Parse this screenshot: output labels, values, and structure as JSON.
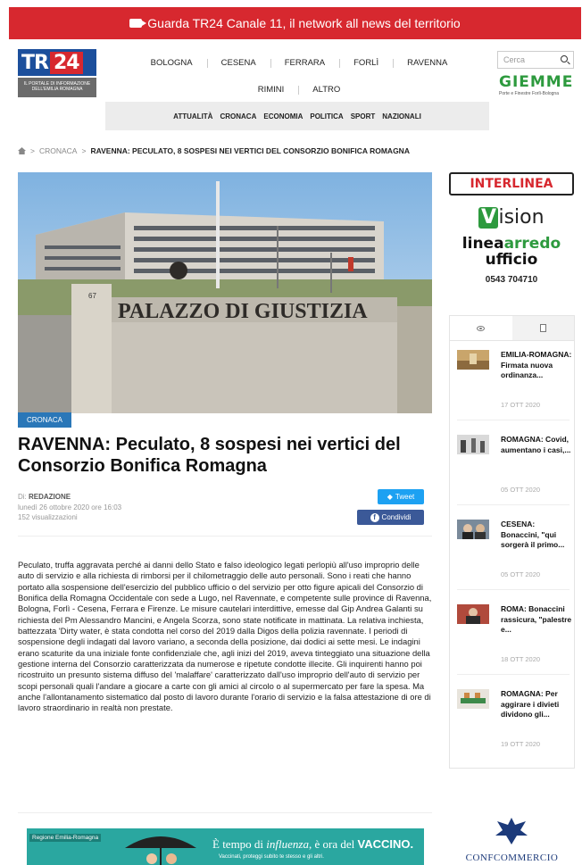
{
  "topbar": {
    "text": "Guarda TR24 Canale 11, il network all news del territorio"
  },
  "logo": {
    "main": "TR",
    "num": "24",
    "tagline": "IL PORTALE DI INFORMAZIONE DELL'EMILIA ROMAGNA"
  },
  "nav": {
    "cities_row1": [
      "BOLOGNA",
      "CESENA",
      "FERRARA",
      "FORLÌ",
      "RAVENNA"
    ],
    "cities_row2": [
      "RIMINI",
      "ALTRO"
    ],
    "categories": [
      "ATTUALITÀ",
      "CRONACA",
      "ECONOMIA",
      "POLITICA",
      "SPORT",
      "NAZIONALI"
    ]
  },
  "search": {
    "placeholder": "Cerca"
  },
  "sponsor_top": {
    "name": "GIEMME",
    "sub": "Porte e Finestre Forlì-Bologna"
  },
  "breadcrumb": {
    "section": "CRONACA",
    "current": "RAVENNA: PECULATO, 8 SOSPESI NEI VERTICI DEL CONSORZIO BONIFICA ROMAGNA"
  },
  "hero": {
    "sign": "PALAZZO DI GIUSTIZIA",
    "number": "67"
  },
  "article": {
    "category": "CRONACA",
    "title": "RAVENNA: Peculato, 8 sospesi nei vertici del Consorzio Bonifica Romagna",
    "author_prefix": "Di: ",
    "author": "REDAZIONE",
    "date": "lunedì 26 ottobre 2020 ore 16:03",
    "views": "152 visualizzazioni",
    "tweet": "Tweet",
    "share": "Condividi",
    "body": "Peculato, truffa aggravata perché ai danni dello Stato e falso ideologico legati perlopiù all'uso improprio delle auto di servizio e alla richiesta di rimborsi per il chilometraggio delle auto personali. Sono i reati che hanno portato alla sospensione dell'esercizio del pubblico ufficio o del servizio per otto figure apicali del Consorzio di Bonifica della Romagna Occidentale con sede a Lugo, nel Ravennate, e competente sulle province di Ravenna, Bologna, Forlì - Cesena, Ferrara e Firenze. Le misure cautelari interdittive, emesse dal Gip Andrea Galanti su richiesta del Pm Alessandro Mancini, e Angela Scorza, sono state notificate in mattinata. La relativa inchiesta, battezzata 'Dirty water, è stata condotta nel corso del 2019 dalla Digos della polizia ravennate. I periodi di sospensione degli indagati dal lavoro variano, a seconda della posizione, dai dodici ai sette mesi. Le indagini erano scaturite da una iniziale fonte confidenziale che, agli inizi del 2019, aveva tinteggiato una situazione della gestione interna del Consorzio caratterizzata da numerose e ripetute condotte illecite. Gli inquirenti hanno poi ricostruito un presunto sistema diffuso del 'malaffare' caratterizzato dall'uso improprio dell'auto di servizio per scopi personali quali l'andare a giocare a carte con gli amici al circolo o al supermercato per fare la spesa. Ma anche l'allontanamento sistematico dal posto di lavoro durante l'orario di servizio e la falsa attestazione di ore di lavoro straordinario in realtà non prestate."
  },
  "ad_right": {
    "interlinea": "INTERLINEA",
    "vision": "ision",
    "vision_v": "V",
    "linea_a": "linea",
    "linea_b": "arredo",
    "linea_c": "ufficio",
    "phone": "0543 704710"
  },
  "sidebar_news": [
    {
      "title": "EMILIA-ROMAGNA: Firmata nuova ordinanza...",
      "date": "17 OTT 2020"
    },
    {
      "title": "ROMAGNA: Covid, aumentano i casi,...",
      "date": "05 OTT 2020"
    },
    {
      "title": "CESENA: Bonaccini, \"qui sorgerà il primo...",
      "date": "05 OTT 2020"
    },
    {
      "title": "ROMA: Bonaccini rassicura, \"palestre e...",
      "date": "18 OTT 2020"
    },
    {
      "title": "ROMAGNA: Per aggirare i divieti dividono gli...",
      "date": "19 OTT 2020"
    }
  ],
  "bottom_banner": {
    "logo": "Regione Emilia-Romagna",
    "headline_a": "È tempo di ",
    "headline_b": "influenza",
    "headline_c": ", è ora del ",
    "headline_d": "VACCINO.",
    "sub": "Vaccinati, proteggi subito te stesso e gli altri."
  },
  "confcommercio": "CONFCOMMERCIO",
  "colors": {
    "brand_red": "#d7282f",
    "brand_blue": "#1c4f9c",
    "category_blue": "#2a77b8",
    "sponsor_green": "#2d9a3e"
  }
}
